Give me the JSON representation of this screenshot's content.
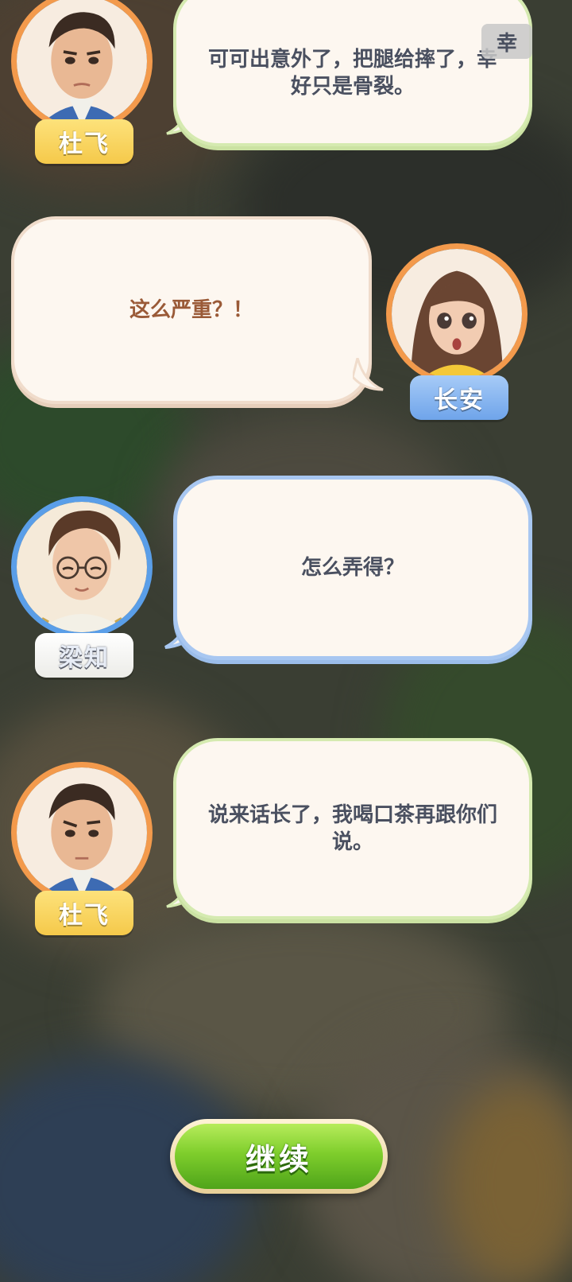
{
  "dialogue": [
    {
      "speaker": "杜飞",
      "text": "可可出意外了，把腿给摔了，幸好只是骨裂。"
    },
    {
      "speaker": "长安",
      "text": "这么严重？！"
    },
    {
      "speaker": "梁知",
      "text": "怎么弄得？"
    },
    {
      "speaker": "杜飞",
      "text": "说来话长了，我喝口茶再跟你们说。"
    }
  ],
  "overlay_chip": "幸",
  "continue_label": "继续",
  "colors": {
    "bubble_fill": "#fdf7f0",
    "green_border": "#d5eab0",
    "blue_border": "#a8c7f1",
    "orange_ring": "#f39a4c",
    "blue_ring": "#5a9ee8",
    "button_green": "#7fce2c"
  }
}
